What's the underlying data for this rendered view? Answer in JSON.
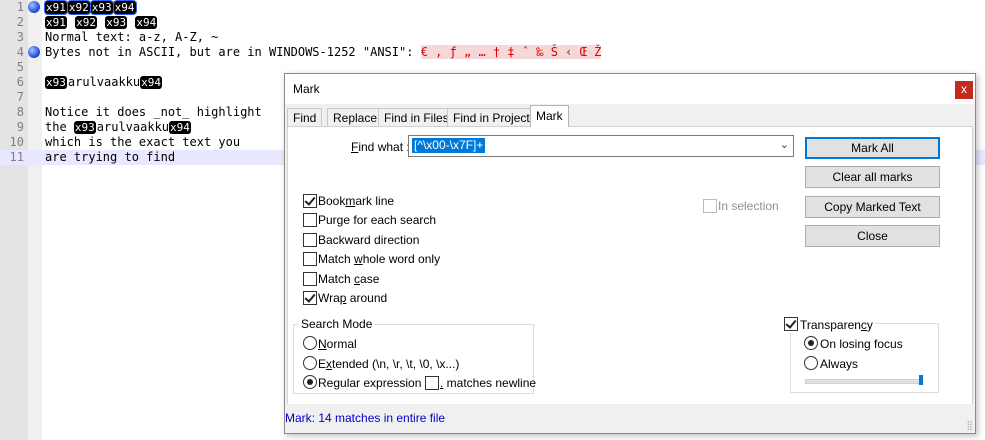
{
  "editor": {
    "line_numbers": [
      "1",
      "2",
      "3",
      "4",
      "5",
      "6",
      "7",
      "8",
      "9",
      "10",
      "11"
    ],
    "line1_tokens": [
      "x91",
      "x92",
      "x93",
      "x94"
    ],
    "line2_tokens": [
      "x91",
      "x92",
      "x93",
      "x94"
    ],
    "line3": "Normal text: a-z, A-Z, ~",
    "line4_text": "Bytes not in ASCII, but are in WINDOWS-1252 \"ANSI\": ",
    "line4_chars": "€ ‚ ƒ „ … † ‡ ˆ ‰ Š ‹ Œ Ž",
    "line6_token_a": "x93",
    "line6_text": "arulvaakku",
    "line6_token_b": "x94",
    "line8": "Notice it does _not_ highlight",
    "line9_prefix": "the ",
    "line9_token_a": "x93",
    "line9_text": "arulvaakku",
    "line9_token_b": "x94",
    "line10": "which is the exact text you",
    "line11": "are trying to find"
  },
  "dialog": {
    "title": "Mark",
    "close_glyph": "x",
    "tabs": [
      "Find",
      "Replace",
      "Find in Files",
      "Find in Projects",
      "Mark"
    ],
    "find_what_label_u": "F",
    "find_what_label_rest": "ind what :",
    "find_what_value": "[^\\x00-\\x7F]+",
    "combo_arrow": "⌄",
    "buttons": {
      "mark_all": "Mark All",
      "clear_all_marks": "Clear all marks",
      "copy_marked_text": "Copy Marked Text",
      "close": "Close"
    },
    "options": {
      "bookmark_line": {
        "pre": "Book",
        "u": "m",
        "post": "ark line",
        "checked": true
      },
      "purge": {
        "label": "Purge for each search",
        "checked": false
      },
      "backward": {
        "label": "Backward direction",
        "checked": false
      },
      "whole_word": {
        "pre": "Match ",
        "u": "w",
        "post": "hole word only",
        "checked": false
      },
      "match_case": {
        "pre": "Match ",
        "u": "c",
        "post": "ase",
        "checked": false
      },
      "wrap_around": {
        "pre": "Wra",
        "u": "p",
        "post": " around",
        "checked": true
      },
      "in_selection": {
        "label": "In selection",
        "checked": false,
        "disabled": true
      }
    },
    "search_mode": {
      "title": "Search Mode",
      "normal": {
        "u": "N",
        "post": "ormal",
        "selected": false
      },
      "extended": {
        "pre": "E",
        "u": "x",
        "post": "tended (\\n, \\r, \\t, \\0, \\x...)",
        "selected": false
      },
      "regex": {
        "pre": "Re",
        "u": "g",
        "post": "ular expression",
        "selected": true
      },
      "matches_newline": {
        "u": ".",
        "post": " matches newline",
        "checked": false
      }
    },
    "transparency": {
      "pre": "Transparen",
      "u": "c",
      "post": "y",
      "checked": true,
      "on_losing_focus": "On losing focus",
      "always": "Always",
      "selected": "on_losing_focus",
      "slider_level": 1.0
    },
    "status": "Mark: 14 matches in entire file",
    "grip": "⣿"
  }
}
